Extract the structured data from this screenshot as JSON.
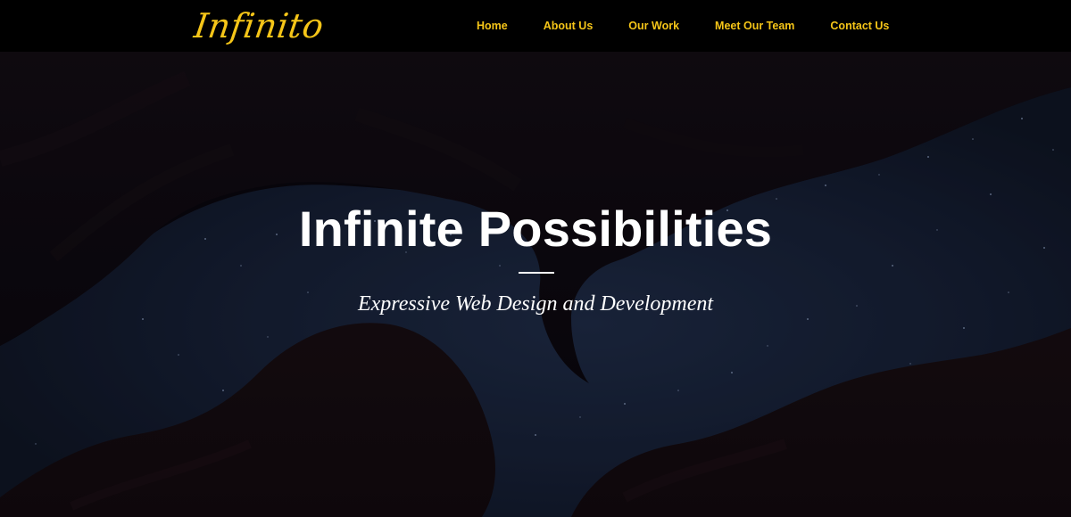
{
  "nav": {
    "logo": "Infinito",
    "links": [
      {
        "label": "Home"
      },
      {
        "label": "About Us"
      },
      {
        "label": "Our Work"
      },
      {
        "label": "Meet Our Team"
      },
      {
        "label": "Contact Us"
      }
    ]
  },
  "hero": {
    "title": "Infinite Possibilities",
    "subtitle": "Expressive Web Design and Development"
  },
  "colors": {
    "accent": "#f5c518",
    "navbar_bg": "#000000",
    "hero_bg": "#0b0710",
    "sky": "#1a2540",
    "text": "#ffffff"
  }
}
